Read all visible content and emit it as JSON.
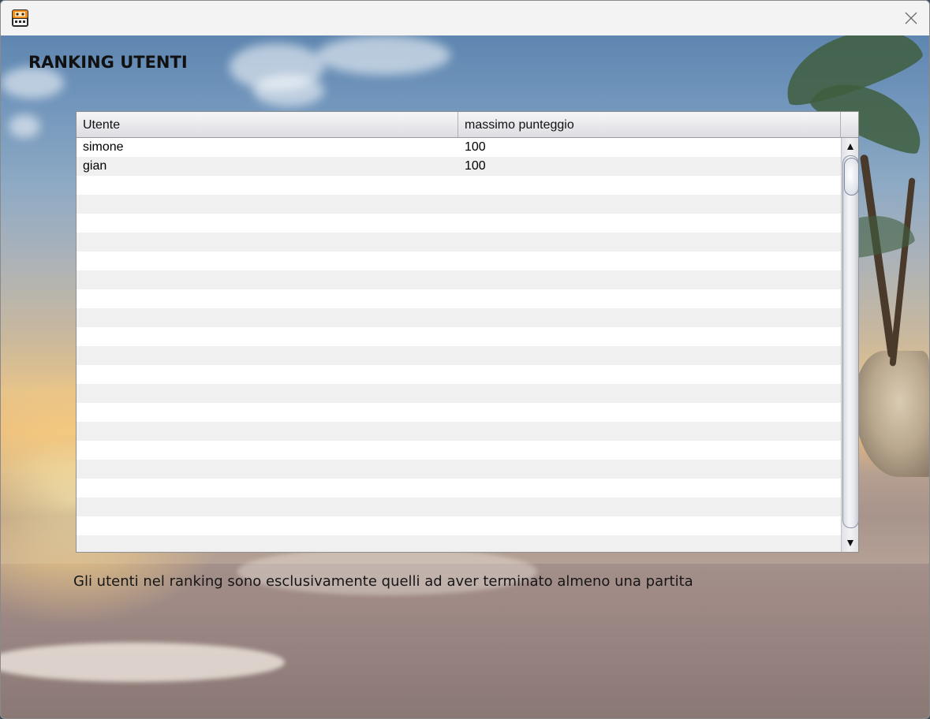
{
  "window": {
    "app_icon": "arcade-machine-icon",
    "close_icon": "close-icon"
  },
  "page": {
    "heading": "RANKING UTENTI",
    "footnote": "Gli utenti nel ranking sono esclusivamente quelli ad aver terminato almeno una partita"
  },
  "table": {
    "columns": [
      "Utente",
      "massimo punteggio"
    ],
    "rows": [
      [
        "simone",
        "100"
      ],
      [
        "gian",
        "100"
      ]
    ],
    "scroll_up_icon": "arrow-up-icon",
    "scroll_down_icon": "arrow-down-icon"
  },
  "colors": {
    "row_alt": "#f0f0f0",
    "header_bg": "#e8e8ec",
    "titlebar": "#f3f3f3"
  }
}
